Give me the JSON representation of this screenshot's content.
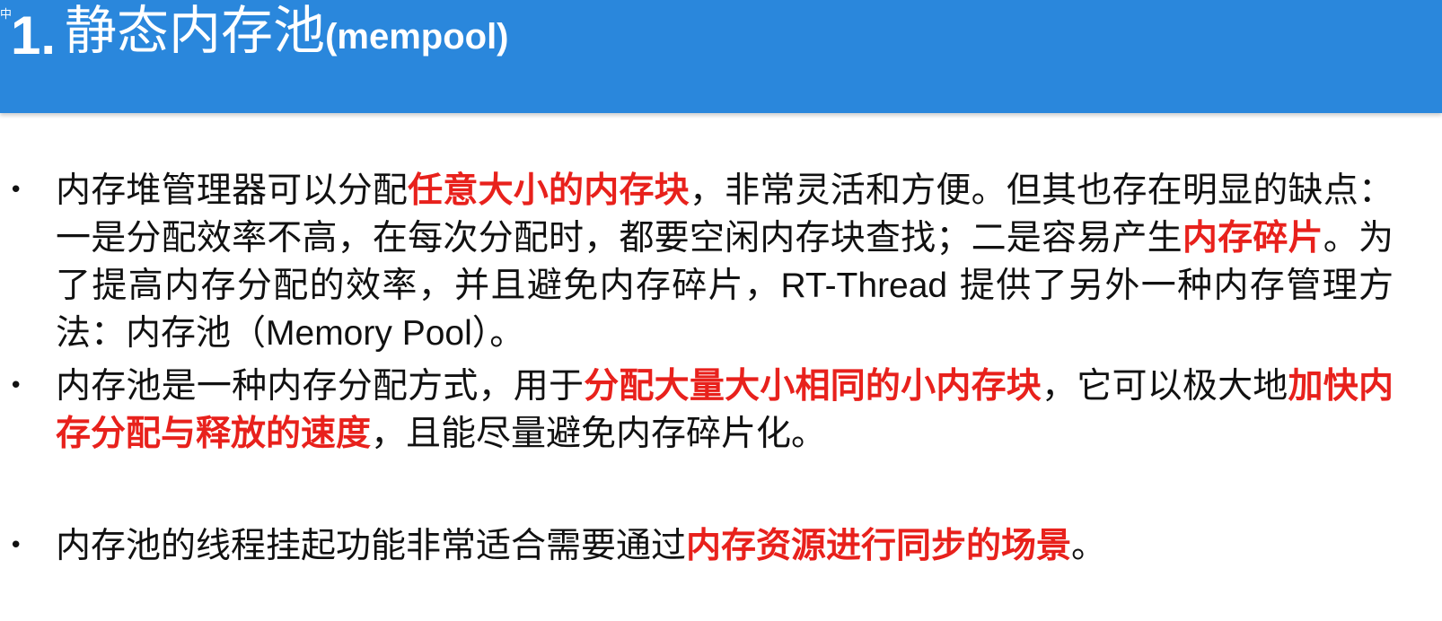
{
  "header": {
    "corner_mark": "中",
    "title_number": "1.",
    "title_cn": "静态内存池",
    "title_en": "(mempool)",
    "bg_color": "#2a87dc"
  },
  "colors": {
    "emphasis": "#e8211c",
    "body_text": "#111111"
  },
  "bullets": [
    {
      "segments": [
        {
          "text": "内存堆管理器可以分配",
          "emphasis": false
        },
        {
          "text": "任意大小的内存块",
          "emphasis": true
        },
        {
          "text": "，非常灵活和方便。但其也存在明显的缺点：一是分配效率不高，在每次分配时，都要空闲内存块查找；二是容易产生",
          "emphasis": false
        },
        {
          "text": "内存碎片",
          "emphasis": true
        },
        {
          "text": "。为了提高内存分配的效率，并且避免内存碎片，",
          "emphasis": false
        },
        {
          "text": "RT-Thread",
          "emphasis": false,
          "latin": true
        },
        {
          "text": " 提供了另外一种内存管理方法：内存池（",
          "emphasis": false
        },
        {
          "text": "Memory Pool",
          "emphasis": false,
          "latin": true
        },
        {
          "text": "）。",
          "emphasis": false
        }
      ]
    },
    {
      "segments": [
        {
          "text": "内存池是一种内存分配方式，用于",
          "emphasis": false
        },
        {
          "text": "分配大量大小相同的小内存块",
          "emphasis": true
        },
        {
          "text": "，它可以极大地",
          "emphasis": false
        },
        {
          "text": "加快内存分配与释放的速度",
          "emphasis": true
        },
        {
          "text": "，且能尽量避免内存碎片化。",
          "emphasis": false
        }
      ]
    },
    {
      "segments": [
        {
          "text": "内存池的线程挂起功能非常适合需要通过",
          "emphasis": false
        },
        {
          "text": "内存资源进行同步的场景",
          "emphasis": true
        },
        {
          "text": "。",
          "emphasis": false
        }
      ]
    }
  ]
}
